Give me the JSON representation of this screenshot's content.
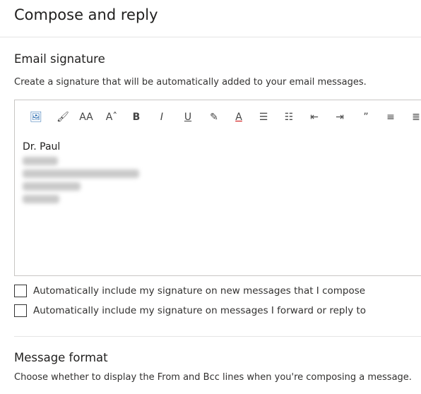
{
  "title": "Compose and reply",
  "signature": {
    "heading": "Email signature",
    "description": "Create a signature that will be automatically added to your email messages.",
    "content_first_line": "Dr. Paul"
  },
  "toolbar": [
    {
      "icon": "image-icon",
      "glyph": "🖼"
    },
    {
      "icon": "format-painter-icon",
      "glyph": "🖌"
    },
    {
      "icon": "font-size-icon",
      "glyph": "AA"
    },
    {
      "icon": "grow-font-icon",
      "glyph": "Aˆ"
    },
    {
      "icon": "bold-icon",
      "glyph": "B"
    },
    {
      "icon": "italic-icon",
      "glyph": "I"
    },
    {
      "icon": "underline-icon",
      "glyph": "U"
    },
    {
      "icon": "highlight-icon",
      "glyph": "✎"
    },
    {
      "icon": "font-color-icon",
      "glyph": "A"
    },
    {
      "icon": "bullets-icon",
      "glyph": "☰"
    },
    {
      "icon": "numbering-icon",
      "glyph": "☷"
    },
    {
      "icon": "decrease-indent-icon",
      "glyph": "⇤"
    },
    {
      "icon": "increase-indent-icon",
      "glyph": "⇥"
    },
    {
      "icon": "quote-icon",
      "glyph": "”"
    },
    {
      "icon": "align-left-icon",
      "glyph": "≡"
    },
    {
      "icon": "align-right-icon",
      "glyph": "≣"
    }
  ],
  "options": [
    {
      "label": "Automatically include my signature on new messages that I compose",
      "checked": false
    },
    {
      "label": "Automatically include my signature on messages I forward or reply to",
      "checked": false
    }
  ],
  "format": {
    "heading": "Message format",
    "description": "Choose whether to display the From and Bcc lines when you're composing a message."
  }
}
